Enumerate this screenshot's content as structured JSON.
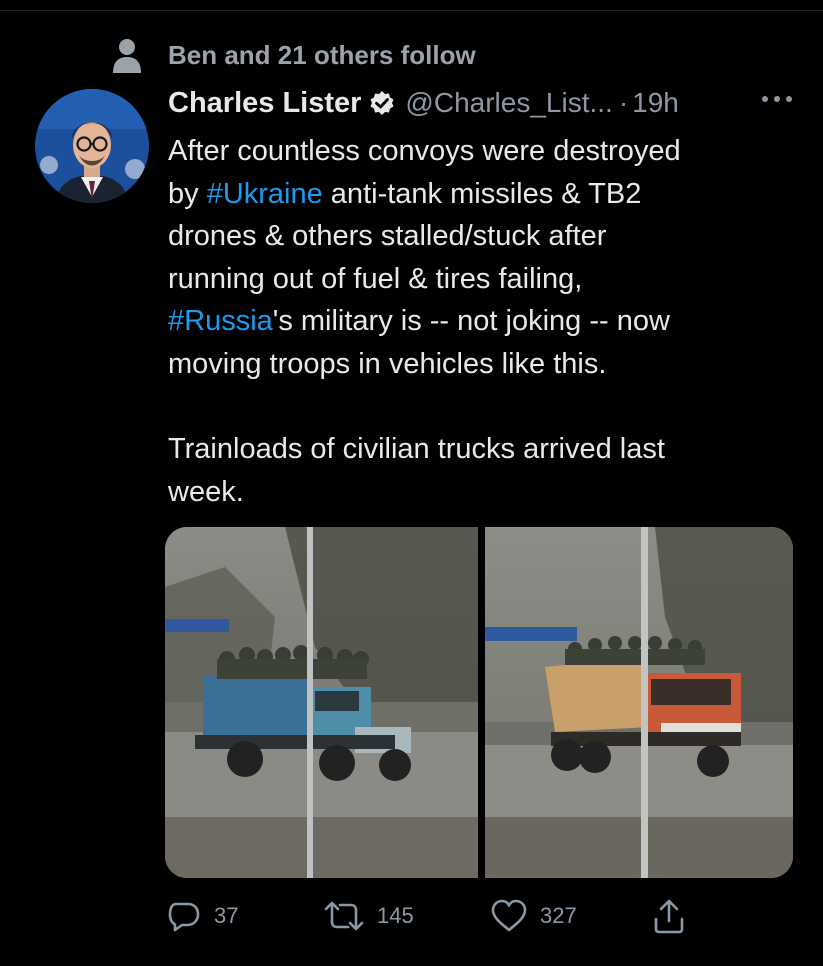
{
  "social_context": {
    "text": "Ben and 21 others follow",
    "icon": "person-icon"
  },
  "tweet": {
    "author_name": "Charles Lister",
    "verified": true,
    "handle": "@Charles_List...",
    "separator": "·",
    "time": "19h",
    "more_icon": "ellipsis-icon",
    "text": {
      "p1_part1": "After countless convoys were destroyed\nby ",
      "tag1": "#Ukraine",
      "p1_part2": " anti-tank missiles & TB2\ndrones & others stalled/stuck after\nrunning out of fuel & tires failing,\n",
      "tag2": "#Russia",
      "p1_part3": "'s military is -- not joking -- now\nmoving troops in vehicles like this.",
      "p2": "Trainloads of civilian trucks arrived last\nweek."
    },
    "colors": {
      "hashtag": "#1d9bf0",
      "muted": "#8b98a5",
      "background": "#000000"
    }
  },
  "actions": {
    "reply": {
      "icon": "reply-icon",
      "count": "37"
    },
    "retweet": {
      "icon": "retweet-icon",
      "count": "145"
    },
    "like": {
      "icon": "heart-icon",
      "count": "327"
    },
    "share": {
      "icon": "share-icon"
    }
  }
}
